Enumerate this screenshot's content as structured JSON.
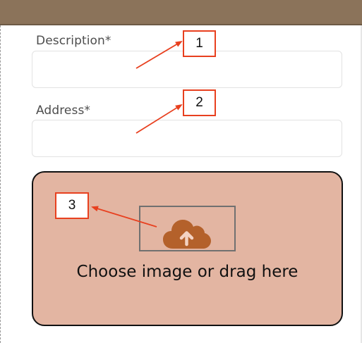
{
  "form": {
    "description": {
      "label": "Description*",
      "value": "",
      "placeholder": ""
    },
    "address": {
      "label": "Address*",
      "value": "",
      "placeholder": ""
    }
  },
  "upload": {
    "text": "Choose image or drag here",
    "icon": "cloud-upload-icon"
  },
  "annotations": [
    "1",
    "2",
    "3"
  ],
  "colors": {
    "header": "#8b735a",
    "dropzone_bg": "#e3b5a2",
    "upload_icon": "#b4612b",
    "annotation": "#e8401f"
  }
}
